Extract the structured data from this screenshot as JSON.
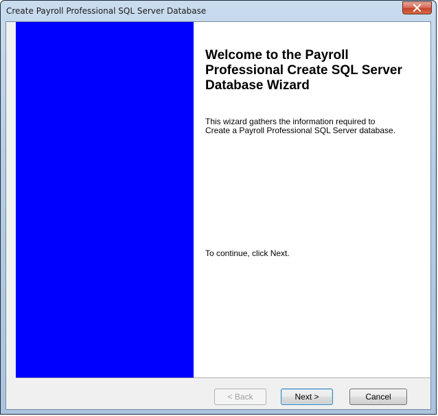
{
  "window": {
    "title": "Create Payroll Professional SQL Server Database",
    "close_icon": "close-icon"
  },
  "colors": {
    "side_panel": "#0000ff",
    "content_bg": "#ffffff",
    "dialog_bg": "#f0f0f0"
  },
  "wizard": {
    "heading": "Welcome to the Payroll Professional Create SQL Server Database Wizard",
    "description": "This wizard gathers the information required to Create a Payroll Professional SQL Server database.",
    "continue_text": "To continue, click Next."
  },
  "buttons": {
    "back": "< Back",
    "next": "Next >",
    "cancel": "Cancel"
  }
}
